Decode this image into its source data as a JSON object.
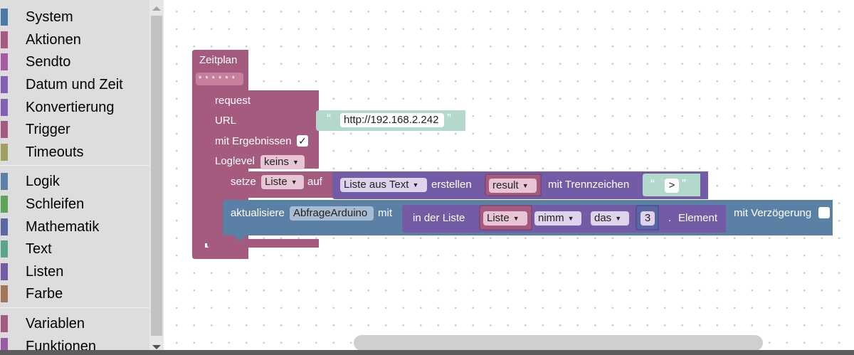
{
  "toolbox": {
    "categories": [
      {
        "label": "System",
        "color": "#4a79a6"
      },
      {
        "label": "Aktionen",
        "color": "#a65a80"
      },
      {
        "label": "Sendto",
        "color": "#a65aa6"
      },
      {
        "label": "Datum und Zeit",
        "color": "#8060b3"
      },
      {
        "label": "Konvertierung",
        "color": "#8060b3"
      },
      {
        "label": "Trigger",
        "color": "#a65a80"
      },
      {
        "label": "Timeouts",
        "color": "#a0a060"
      },
      {
        "label": "Logik",
        "color": "#5b80a5"
      },
      {
        "label": "Schleifen",
        "color": "#5ba55b"
      },
      {
        "label": "Mathematik",
        "color": "#5b67a5"
      },
      {
        "label": "Text",
        "color": "#5ba58c"
      },
      {
        "label": "Listen",
        "color": "#745ba5"
      },
      {
        "label": "Farbe",
        "color": "#a5745b"
      },
      {
        "label": "Variablen",
        "color": "#a55b80"
      },
      {
        "label": "Funktionen",
        "color": "#995ba5"
      }
    ]
  },
  "blocks": {
    "schedule": {
      "title": "Zeitplan",
      "cron": "* * * * * *"
    },
    "request": {
      "title": "request",
      "url_label": "URL",
      "url_value": "http://192.168.2.242",
      "with_results_label": "mit Ergebnissen",
      "with_results_checked": "✓",
      "loglevel_label": "Loglevel",
      "loglevel_value": "keins"
    },
    "set_var": {
      "set_label": "setze",
      "var_name": "Liste",
      "to_label": "auf",
      "list_from_text": "Liste aus Text",
      "create_label": "erstellen",
      "source_var": "result",
      "delimiter_label": "mit Trennzeichen",
      "delimiter_value": ">"
    },
    "update": {
      "update_label": "aktualisiere",
      "object_name": "AbfrageArduino",
      "with_label": "mit",
      "in_list_label": "in der Liste",
      "list_var": "Liste",
      "take_value": "nimm",
      "the_value": "das",
      "index_value": "3",
      "dot": ".",
      "element_label": "Element",
      "delay_label": "mit Verzögerung"
    }
  },
  "quote_open": "“",
  "quote_close": "”",
  "dropdown_caret": "▼"
}
